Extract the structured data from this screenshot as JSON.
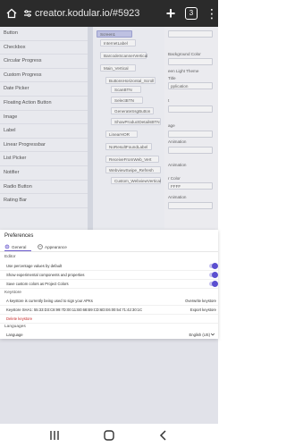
{
  "browser": {
    "url": "creator.kodular.io/#5923",
    "tab_count": "3",
    "menu_glyph": "⋮",
    "plus_glyph": "+"
  },
  "palette": {
    "items": [
      "Button",
      "Checkbox",
      "Circular Progress",
      "Custom Progress",
      "Date Picker",
      "Floating Action Button",
      "Image",
      "Label",
      "Linear Progressbar",
      "List Picker",
      "Notifier",
      "Radio Button",
      "Rating Bar"
    ]
  },
  "tree": {
    "items": [
      "Screen1",
      "InternetLabel",
      "BarcodeScannerVertical",
      "Main_Vertical",
      "ButtonsHorizontal_Scroll",
      "ScanBTN",
      "SelectBTN",
      "GenerateSsgButton",
      "ShowProductDetailsBTN",
      "LinearHOR",
      "NoResultFoundLabel",
      "ReceiveFromWeb_Vert",
      "WebviewSwipe_Refresh",
      "Custom_WebviewVertical"
    ]
  },
  "props": {
    "labels": [
      "Background Color",
      "een Light Theme",
      "Title",
      "pplication",
      "t",
      "age",
      "Animation",
      "Animation",
      "r Color",
      "FFFF",
      "Animation"
    ]
  },
  "dialog": {
    "title": "Preferences",
    "tabs": [
      {
        "label": "General",
        "icon": "gear-icon",
        "active": true
      },
      {
        "label": "Appearance",
        "icon": "palette-icon",
        "active": false
      }
    ],
    "editor": {
      "heading": "Editor",
      "rows": [
        {
          "label": "Use percentage values by default",
          "on": true
        },
        {
          "label": "Show experimental components and properties",
          "on": true
        },
        {
          "label": "Save custom colors as Project Colors",
          "on": true
        }
      ]
    },
    "keystore": {
      "heading": "Keystore",
      "info": "A keystore is currently being used to sign your APKs",
      "overwrite_label": "Overwrite keystore",
      "sha_text": "Keystore SHA1: 55:33:D3:C8:99:7D:00:11:B0:68:B9:CD:6D:E6:00:54:71:42:30:1C",
      "export_label": "Export keystore",
      "delete_label": "Delete keystore"
    },
    "languages": {
      "heading": "Languages",
      "label": "Language",
      "value": "English (US)"
    }
  },
  "colors": {
    "accent": "#5b4fd0",
    "danger": "#c62828"
  }
}
